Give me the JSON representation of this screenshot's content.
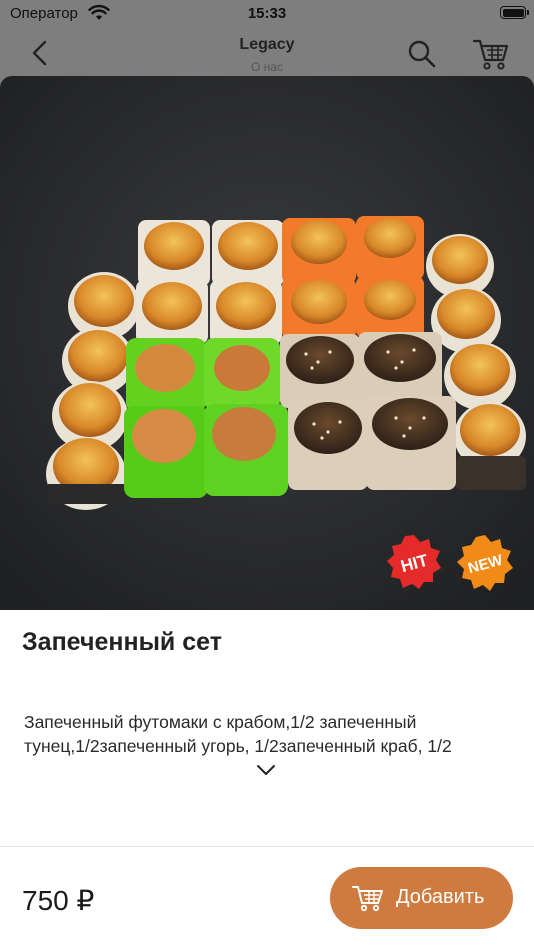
{
  "status_bar": {
    "carrier": "Оператор",
    "time": "15:33"
  },
  "nav": {
    "title": "Legacy",
    "subtitle": "О нас"
  },
  "product": {
    "badges": [
      "HIT",
      "NEW"
    ],
    "title": "Запеченный сет",
    "description": "Запеченный футомаки с крабом,1/2 запеченный тунец,1/2запеченный угорь, 1/2запеченный краб, 1/2",
    "price": "750 ₽"
  },
  "actions": {
    "add_label": "Добавить"
  },
  "colors": {
    "accent": "#cf7a3e",
    "badge_hit": "#e52a2a",
    "badge_new": "#f28a17"
  }
}
